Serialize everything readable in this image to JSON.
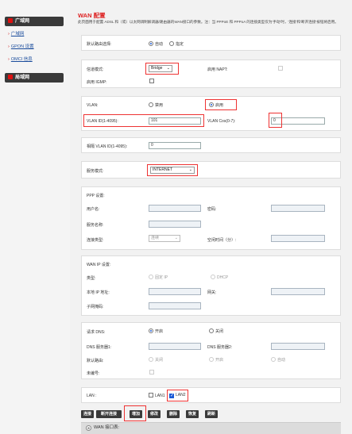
{
  "sidebar": {
    "section1": "广域网",
    "links": [
      "广域网",
      "GPON 设置",
      "OMCI 信息"
    ],
    "section2": "局域网"
  },
  "page": {
    "title": "WAN 配置",
    "description": "此页面用于配置 ADSL 和（或）以太网调制解调器/路由器的WAN接口的参数。注：当 PPPoE 和 PPPoA 的连接类型仅为'手动'时，'连接'和'断开连接'按钮将启用。"
  },
  "default_route": {
    "label": "默认路由选择:",
    "options": [
      "自动",
      "指定"
    ],
    "selected": "自动"
  },
  "channel": {
    "mode_label": "信道模式:",
    "mode_value": "Bridge",
    "napt_label": "启用 NAPT:",
    "igmp_label": "启用 IGMP:"
  },
  "vlan": {
    "label": "VLAN:",
    "disable": "禁用",
    "enable": "启用",
    "selected": "启用",
    "id_label": "VLAN ID(1-4095):",
    "id_value": "101",
    "cos_label": "VLAN Cos(0-7):",
    "cos_value": "0"
  },
  "mapped_vlan": {
    "label": "相隔 VLAN ID(1-4095):",
    "value": "0"
  },
  "service": {
    "label": "服务模式:",
    "value": "INTERNET"
  },
  "ppp": {
    "title": "PPP 设置:",
    "user_label": "用户名:",
    "password_label": "密码:",
    "service_label": "服务名称:",
    "conn_type_label": "连接类型:",
    "conn_type_value": "连续",
    "idle_label": "空闲时间（分）:"
  },
  "wan_ip": {
    "title": "WAN IP 设置:",
    "type_label": "类型:",
    "fixed_ip": "固定 IP",
    "dhcp": "DHCP",
    "local_ip_label": "本地 IP 地址:",
    "gateway_label": "网关:",
    "subnet_label": "子网掩码:"
  },
  "dns": {
    "request_label": "请求 DNS:",
    "on": "开启",
    "off": "关闭",
    "selected": "开启",
    "dns1_label": "DNS 服务器1:",
    "dns2_label": "DNS 服务器2:",
    "default_route_label": "默认路由:",
    "dr_off": "关闭",
    "dr_on": "开启",
    "dr_auto": "自动",
    "unnumbered_label": "未编号:"
  },
  "lan": {
    "label": "LAN :",
    "lan1": "LAN1",
    "lan2": "LAN2",
    "lan2_checked": true
  },
  "buttons": [
    "连接",
    "断开连接",
    "增加",
    "修改",
    "删除",
    "恢复",
    "刷新"
  ],
  "wan_list_label": "WAN 接口表:"
}
